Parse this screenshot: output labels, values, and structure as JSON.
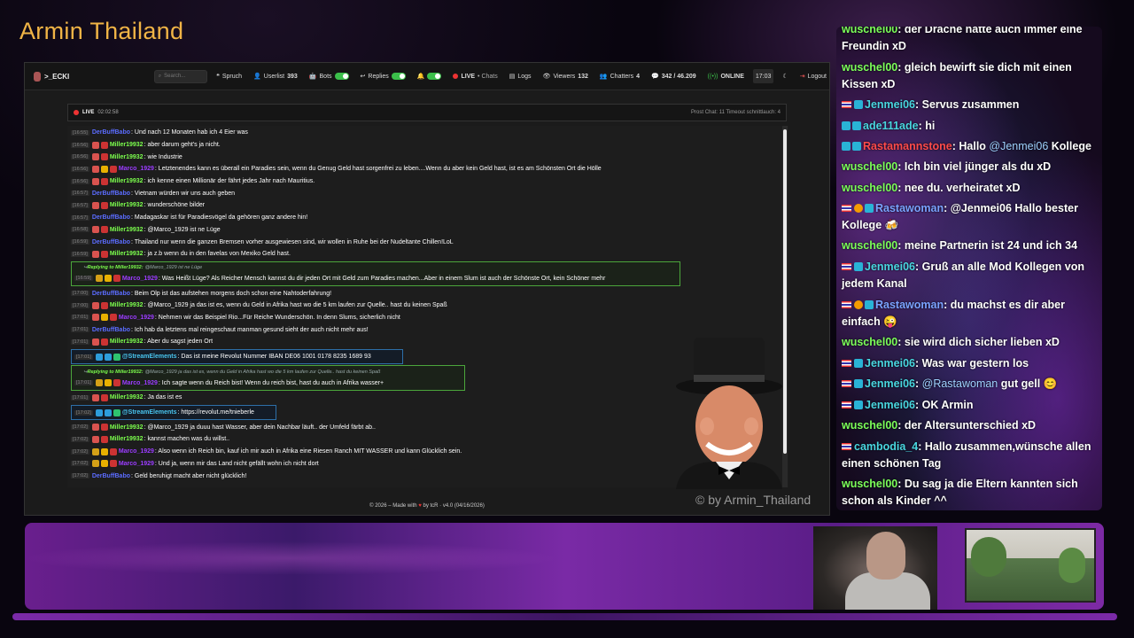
{
  "stream": {
    "title": "Armin Thailand",
    "watermark": "© by Armin_Thailand"
  },
  "topbar": {
    "brand": ">_ECKI",
    "search_placeholder": "Search...",
    "items": [
      {
        "label": "Spruch"
      },
      {
        "label": "Userlist",
        "count": "393"
      },
      {
        "label": "Bots"
      },
      {
        "label": "Replies"
      },
      {
        "label": "LIVE",
        "extra": "• Chats"
      },
      {
        "label": "Logs"
      },
      {
        "label": "Viewers",
        "count": "132"
      },
      {
        "label": "Chatters",
        "count": "4"
      },
      {
        "label": "342 / 46.209"
      },
      {
        "label": "ONLINE"
      },
      {
        "label": "17:03"
      },
      {
        "label": "Logout"
      }
    ]
  },
  "livebar": {
    "status": "LIVE",
    "duration": "02:02:58",
    "right": "Prost Chat: 11  Timeout schnittlauch: 4"
  },
  "messages": [
    {
      "ts": "[16:55]",
      "badges": [],
      "user": "DerBuffBabo",
      "color": "blue",
      "text": ": Und nach 12 Monaten hab ich 4 Eier was"
    },
    {
      "ts": "[16:56]",
      "badges": [
        "mod",
        "vip"
      ],
      "user": "Miller19932",
      "color": "green",
      "text": ": aber darum geht's ja nicht."
    },
    {
      "ts": "[16:56]",
      "badges": [
        "mod",
        "vip"
      ],
      "user": "Miller19932",
      "color": "green",
      "text": ": wie Industrie"
    },
    {
      "ts": "[16:56]",
      "badges": [
        "mod",
        "sub",
        "vip"
      ],
      "user": "Marco_1929",
      "color": "purple",
      "text": ": Letztenendes kann es überall ein Paradies sein, wenn du Genug Geld hast sorgenfrei zu leben....Wenn du aber kein Geld hast, ist es am Schönsten Ort die Hölle"
    },
    {
      "ts": "[16:56]",
      "badges": [
        "mod",
        "vip"
      ],
      "user": "Miller19932",
      "color": "green",
      "text": ": ich kenne einen Millionär der fährt jedes Jahr nach Mauritius."
    },
    {
      "ts": "[16:57]",
      "badges": [],
      "user": "DerBuffBabo",
      "color": "blue",
      "text": ": Vietnam würden wir uns auch geben"
    },
    {
      "ts": "[16:57]",
      "badges": [
        "mod",
        "vip"
      ],
      "user": "Miller19932",
      "color": "green",
      "text": ": wunderschöne bilder"
    },
    {
      "ts": "[16:57]",
      "badges": [],
      "user": "DerBuffBabo",
      "color": "blue",
      "text": ": Madagaskar ist für Paradiesvögel da gehören ganz andere hin!"
    },
    {
      "ts": "[16:58]",
      "badges": [
        "mod",
        "vip"
      ],
      "user": "Miller19932",
      "color": "green",
      "text": ": @Marco_1929 ist ne Lüge"
    },
    {
      "ts": "[16:59]",
      "badges": [],
      "user": "DerBuffBabo",
      "color": "blue",
      "text": ": Thailand nur wenn die ganzen Bremsen vorher ausgewiesen sind, wir wollen in Ruhe bei der Nudeltante Chillen!LoL"
    },
    {
      "ts": "[16:59]",
      "badges": [
        "mod",
        "vip"
      ],
      "user": "Miller19932",
      "color": "green",
      "text": ": ja z.b wenn du in den favelas von Mexiko Geld hast."
    }
  ],
  "reply1": {
    "to": "Replying to Miller19932:",
    "quote": "@Marco_1929 ist ne Lüge",
    "ts": "[16:59]",
    "user": "Marco_1929",
    "text": ": Was Heißt Lüge? Als Reicher Mensch kannst du dir jeden Ort mit Geld zum Paradies machen...Aber in einem Slum ist auch der Schönste Ort, kein Schöner mehr"
  },
  "messages2": [
    {
      "ts": "[17:00]",
      "badges": [],
      "user": "DerBuffBabo",
      "color": "blue",
      "text": ": Beim Olp ist das aufstehen morgens doch schon eine Nahtoderfahrung!"
    },
    {
      "ts": "[17:00]",
      "badges": [
        "mod",
        "vip"
      ],
      "user": "Miller19932",
      "color": "green",
      "text": ": @Marco_1929 ja das ist es, wenn du Geld in Afrika hast wo die 5 km laufen zur Quelle.. hast du keinen Spaß"
    },
    {
      "ts": "[17:01]",
      "badges": [
        "mod",
        "sub",
        "vip"
      ],
      "user": "Marco_1929",
      "color": "purple",
      "text": ": Nehmen wir das Beispiel Rio...Für Reiche Wunderschön. In denn Slums, sicherlich nicht"
    },
    {
      "ts": "[17:01]",
      "badges": [],
      "user": "DerBuffBabo",
      "color": "blue",
      "text": ": Ich hab da letztens mal reingeschaut manman gesund sieht der auch nicht mehr aus!"
    },
    {
      "ts": "[17:01]",
      "badges": [
        "mod",
        "vip"
      ],
      "user": "Miller19932",
      "color": "green",
      "text": ": Aber du sagst jeden Ort"
    }
  ],
  "se1": {
    "ts": "[17:01]",
    "user": "@StreamElements",
    "text": ": Das ist meine Revolut Nummer IBAN DE06 1001 0178 8235 1689 93"
  },
  "reply2": {
    "to": "Replying to Miller19932:",
    "quote": "@Marco_1929 ja das ist es, wenn du Geld in Afrika hast wo die 5 km laufen zur Quelle.. hast du keinen Spaß",
    "ts": "[17:01]",
    "user": "Marco_1929",
    "text": ": Ich sagte wenn du Reich bist! Wenn du reich bist, hast du auch in Afrika wasser+"
  },
  "messages3": [
    {
      "ts": "[17:01]",
      "badges": [
        "mod",
        "vip"
      ],
      "user": "Miller19932",
      "color": "green",
      "text": ": Ja das ist es"
    }
  ],
  "se2": {
    "ts": "[17:02]",
    "user": "@StreamElements",
    "text": ": https://revolut.me/tnieberle"
  },
  "messages4": [
    {
      "ts": "[17:02]",
      "badges": [
        "mod",
        "vip"
      ],
      "user": "Miller19932",
      "color": "green",
      "text": ": @Marco_1929 ja duuu hast Wasser, aber dein Nachbar läuft.. der Umfeld färbt ab.."
    },
    {
      "ts": "[17:02]",
      "badges": [
        "mod",
        "vip"
      ],
      "user": "Miller19932",
      "color": "green",
      "text": ": kannst machen was du willst.."
    },
    {
      "ts": "[17:02]",
      "badges": [
        "crown",
        "sub",
        "vip"
      ],
      "user": "Marco_1929",
      "color": "purple",
      "text": ": Also wenn ich Reich bin, kauf ich mir auch in Afrika eine Riesen Ranch MIT WASSER und kann Glücklich sein."
    },
    {
      "ts": "[17:02]",
      "badges": [
        "crown",
        "sub",
        "vip"
      ],
      "user": "Marco_1929",
      "color": "purple",
      "text": ": Und ja, wenn mir das Land nicht gefällt wohn ich nicht dort"
    },
    {
      "ts": "[17:02]",
      "badges": [],
      "user": "DerBuffBabo",
      "color": "blue",
      "text": ": Geld beruhigt macht aber nicht glücklich!"
    }
  ],
  "footer": {
    "pre": "© 2026 – Made with",
    "heart": "♥",
    "post": "by tcR · v4.0 (04/16/2026)"
  },
  "side_chat": [
    {
      "badges": [],
      "user": "wuschel00",
      "ucolor": "g",
      "text": ": der Drache hatte auch immer eine"
    },
    {
      "badges": [],
      "user": "",
      "ucolor": "g",
      "text": "Freundin xD"
    },
    {
      "badges": [],
      "user": "wuschel00",
      "ucolor": "g",
      "text": ": gleich bewirft sie dich mit einen"
    },
    {
      "badges": [],
      "user": "",
      "ucolor": "g",
      "text": "Kissen xD"
    },
    {
      "badges": [
        "fl",
        "c"
      ],
      "user": "Jenmei06",
      "ucolor": "c",
      "text": ": Servus zusammen"
    },
    {
      "badges": [
        "c",
        "c"
      ],
      "user": "ade111ade",
      "ucolor": "c",
      "text": ": hi"
    },
    {
      "badges": [
        "c",
        "c"
      ],
      "user": "Rastamannstone",
      "ucolor": "r",
      "text": ": Hallo ",
      "mention": "@Jenmei06",
      "tail": " Kollege"
    },
    {
      "badges": [],
      "user": "wuschel00",
      "ucolor": "g",
      "text": ": Ich bin viel jünger als du xD"
    },
    {
      "badges": [],
      "user": "wuschel00",
      "ucolor": "g",
      "text": ": nee du. verheiratet xD"
    },
    {
      "badges": [
        "fl",
        "o",
        "c"
      ],
      "user": "Rastawoman",
      "ucolor": "b",
      "text": ": @Jenmei06 Hallo bester"
    },
    {
      "badges": [],
      "user": "",
      "ucolor": "g",
      "text": "Kollege 🍻"
    },
    {
      "badges": [],
      "user": "wuschel00",
      "ucolor": "g",
      "text": ": meine Partnerin ist 24 und ich 34"
    },
    {
      "badges": [
        "fl",
        "c"
      ],
      "user": "Jenmei06",
      "ucolor": "c",
      "text": ": Gruß an alle Mod Kollegen von"
    },
    {
      "badges": [],
      "user": "",
      "ucolor": "g",
      "text": "jedem Kanal"
    },
    {
      "badges": [
        "fl",
        "o",
        "c"
      ],
      "user": "Rastawoman",
      "ucolor": "b",
      "text": ": du machst es dir aber"
    },
    {
      "badges": [],
      "user": "",
      "ucolor": "g",
      "text": "einfach 😜"
    },
    {
      "badges": [],
      "user": "wuschel00",
      "ucolor": "g",
      "text": ": sie wird dich sicher lieben xD"
    },
    {
      "badges": [
        "fl",
        "c"
      ],
      "user": "Jenmei06",
      "ucolor": "c",
      "text": ": Was war gestern los"
    },
    {
      "badges": [
        "fl",
        "c"
      ],
      "user": "Jenmei06",
      "ucolor": "c",
      "text": ": ",
      "mention": "@Rastawoman",
      "tail": " gut gell 😊"
    },
    {
      "badges": [
        "fl",
        "c"
      ],
      "user": "Jenmei06",
      "ucolor": "c",
      "text": ": OK Armin"
    },
    {
      "badges": [],
      "user": "wuschel00",
      "ucolor": "g",
      "text": ": der Altersunterschied xD"
    },
    {
      "badges": [
        "fl"
      ],
      "user": "cambodia_4",
      "ucolor": "c",
      "text": ": Hallo zusammen,wünsche allen"
    },
    {
      "badges": [],
      "user": "",
      "ucolor": "g",
      "text": "einen schönen Tag"
    },
    {
      "badges": [],
      "user": "wuschel00",
      "ucolor": "g",
      "text": ": Du sag ja die Eltern kannten sich"
    },
    {
      "badges": [],
      "user": "",
      "ucolor": "g",
      "text": "schon als Kinder ^^"
    }
  ],
  "colors": {
    "accent": "#f0b446",
    "green_user": "#7cff4d",
    "blue_user": "#5b6cff",
    "purple_user": "#9b3cff",
    "reply_border": "#4ba63b",
    "frame_purple": "#7b2aa8"
  }
}
